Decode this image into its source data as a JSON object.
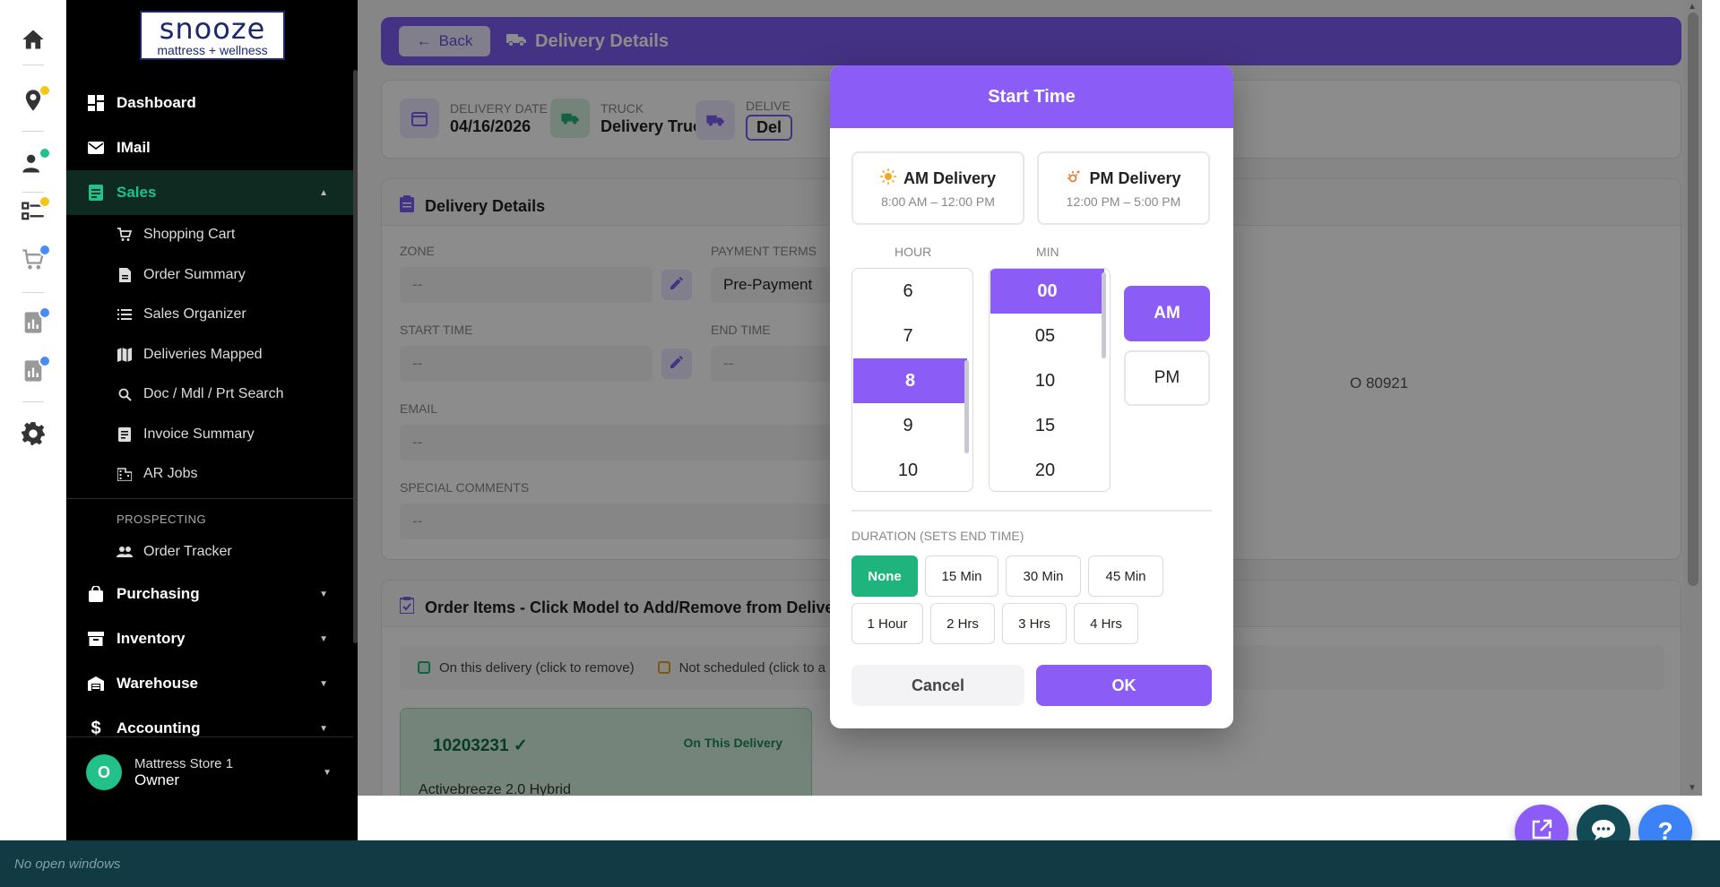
{
  "logo": {
    "brand": "snooze",
    "tagline": "mattress + wellness"
  },
  "rail": {
    "icons": [
      "home-icon",
      "location-pin-icon",
      "user-add-icon",
      "checklist-icon",
      "cart-icon",
      "report-icon",
      "report-2-icon",
      "gear-icon"
    ],
    "badge_colors": {
      "yellow": "#f5c518",
      "green": "#22c18a",
      "blue": "#4a8cf7"
    }
  },
  "sidebar": {
    "nav": {
      "dashboard": "Dashboard",
      "imail": "IMail",
      "sales": "Sales",
      "purchasing": "Purchasing",
      "inventory": "Inventory",
      "warehouse": "Warehouse",
      "accounting": "Accounting"
    },
    "sales_items": [
      "Shopping Cart",
      "Order Summary",
      "Sales Organizer",
      "Deliveries Mapped",
      "Doc / Mdl / Prt Search",
      "Invoice Summary",
      "AR Jobs"
    ],
    "prospecting_label": "PROSPECTING",
    "prospecting_items": [
      "Order Tracker"
    ],
    "user": {
      "initial": "O",
      "store": "Mattress Store 1",
      "role": "Owner"
    },
    "active_color": "#22c18a"
  },
  "page": {
    "back_label": "Back",
    "title": "Delivery Details",
    "info": {
      "date_label": "DELIVERY DATE",
      "date_value": "04/16/2026",
      "truck_label": "TRUCK",
      "truck_value": "Delivery Truck",
      "delivery_label": "DELIVE",
      "delivery_value": "Del"
    },
    "details": {
      "title": "Delivery Details",
      "zone_label": "ZONE",
      "zone_value": "--",
      "payment_label": "PAYMENT TERMS",
      "payment_value": "Pre-Payment",
      "start_label": "START TIME",
      "start_value": "--",
      "end_label": "END TIME",
      "end_value": "--",
      "email_label": "EMAIL",
      "email_value": "--",
      "comments_label": "SPECIAL COMMENTS",
      "comments_value": "--",
      "address_fragment": "O 80921"
    },
    "items": {
      "title": "Order Items - Click Model to Add/Remove from Delive",
      "legend_on": "On this delivery (click to remove)",
      "legend_off": "Not scheduled (click to a",
      "card": {
        "model": "10203231 ✓",
        "status": "On This Delivery",
        "name": "Activebreeze 2.0 Hybrid"
      }
    },
    "accent": "#7c5cf0"
  },
  "modal": {
    "title": "Start Time",
    "am_preset": {
      "title": "AM Delivery",
      "range": "8:00 AM – 12:00 PM"
    },
    "pm_preset": {
      "title": "PM Delivery",
      "range": "12:00 PM – 5:00 PM"
    },
    "hour_label": "HOUR",
    "min_label": "MIN",
    "hours": [
      "6",
      "7",
      "8",
      "9",
      "10"
    ],
    "selected_hour": "8",
    "minutes": [
      "00",
      "05",
      "10",
      "15",
      "20"
    ],
    "selected_minute": "00",
    "am_label": "AM",
    "pm_label": "PM",
    "selected_period": "AM",
    "duration_label": "DURATION (SETS END TIME)",
    "durations": [
      "None",
      "15 Min",
      "30 Min",
      "45 Min",
      "1 Hour",
      "2 Hrs",
      "3 Hrs",
      "4 Hrs"
    ],
    "selected_duration": "None",
    "cancel_label": "Cancel",
    "ok_label": "OK",
    "accent": "#8b5cf6",
    "duration_selected_color": "#1fb37d"
  },
  "fabs": [
    "external-link-icon",
    "chat-icon",
    "help-icon"
  ],
  "fab_help_label": "?",
  "taskbar": {
    "text": "No open windows"
  }
}
